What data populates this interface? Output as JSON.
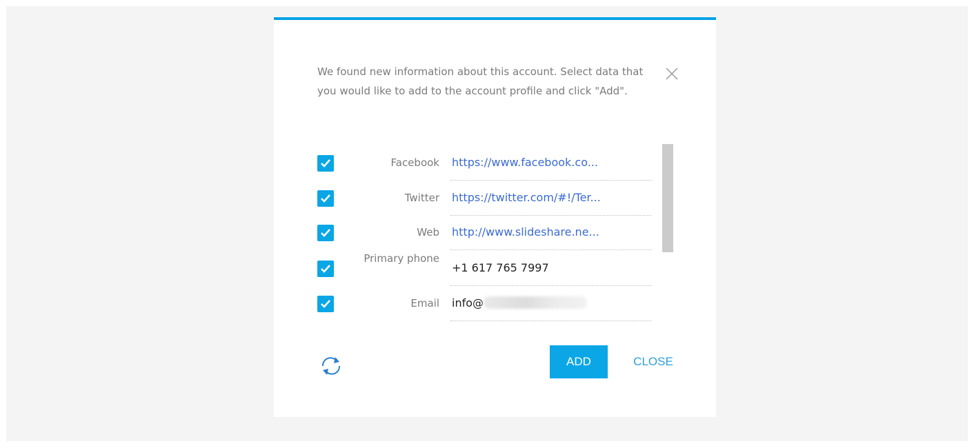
{
  "dialog": {
    "message": "We found new information about this account. Select data that you would like to add to the account profile and click \"Add\".",
    "add_label": "ADD",
    "close_label": "CLOSE",
    "accent_color": "#00a2e6"
  },
  "fields": [
    {
      "label": "Facebook",
      "value": "https://www.facebook.co...",
      "checked": true,
      "type": "link"
    },
    {
      "label": "Twitter",
      "value": "https://twitter.com/#!/Ter...",
      "checked": true,
      "type": "link"
    },
    {
      "label": "Web",
      "value": "http://www.slideshare.ne...",
      "checked": true,
      "type": "link"
    },
    {
      "label": "Primary phone",
      "value": "+1 617 765 7997",
      "checked": true,
      "type": "text"
    },
    {
      "label": "Email",
      "value": "info@",
      "checked": true,
      "type": "text"
    }
  ],
  "icons": {
    "close": "close-icon",
    "checkbox": "checkmark-icon",
    "refresh": "refresh-icon"
  }
}
